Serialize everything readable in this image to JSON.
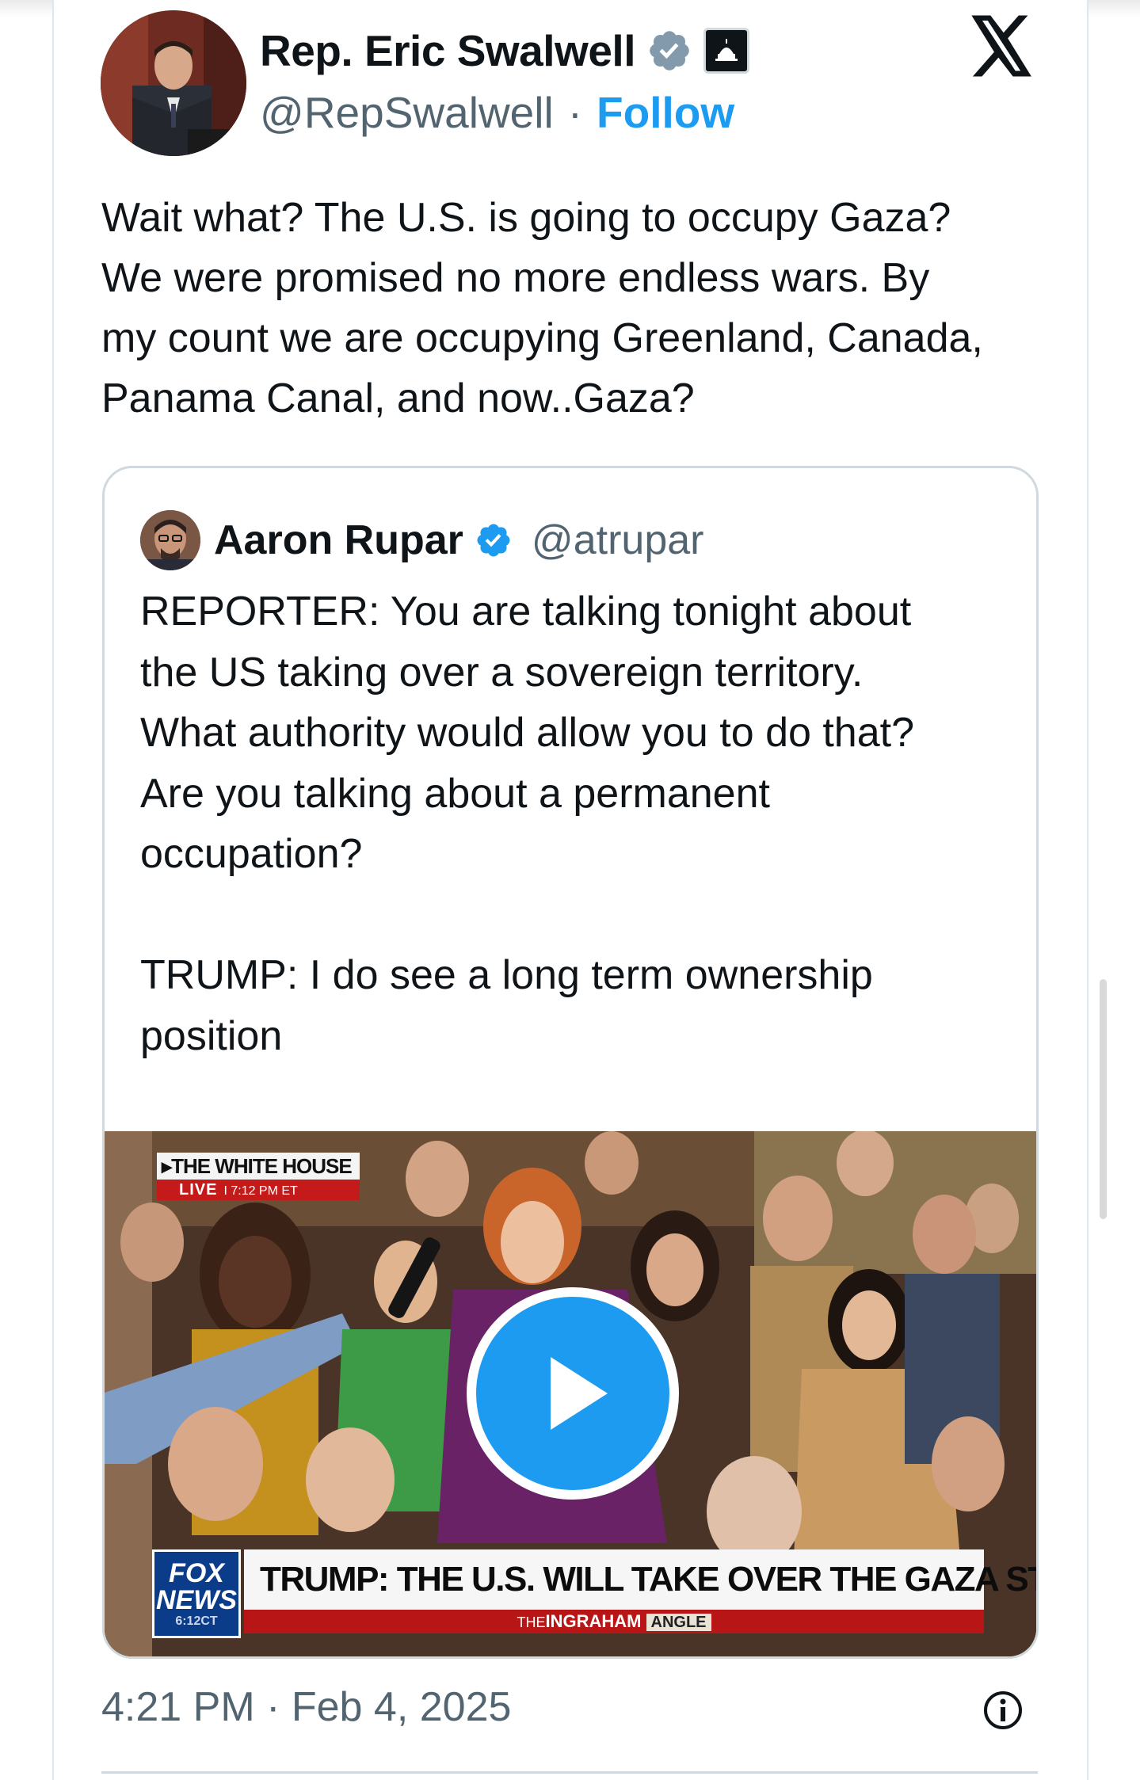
{
  "author": {
    "name": "Rep. Eric Swalwell",
    "handle": "@RepSwalwell",
    "separator": "·",
    "follow_label": "Follow"
  },
  "tweet": {
    "text": "Wait what? The U.S. is going to occupy Gaza?\nWe were promised no more endless wars. By\nmy count we are occupying Greenland, Canada,\nPanama Canal, and now..Gaza?"
  },
  "quote": {
    "name": "Aaron Rupar",
    "handle": "@atrupar",
    "text": "REPORTER: You are talking tonight about\nthe US taking over a sovereign territory.\nWhat authority would allow you to do that?\nAre you talking about a permanent\noccupation?\n\nTRUMP: I do see a long term ownership\nposition",
    "video": {
      "bug_title": "THE WHITE HOUSE",
      "bug_live": "LIVE",
      "bug_time": "I 7:12 PM ET",
      "network_line1": "FOX",
      "network_line2": "NEWS",
      "network_time": "6:12CT",
      "headline": "TRUMP: THE U.S. WILL TAKE OVER THE GAZA STRIP",
      "show_prefix": "THE",
      "show_name": "INGRAHAM",
      "show_suffix": "ANGLE"
    }
  },
  "footer": {
    "timestamp": "4:21 PM · Feb 4, 2025"
  },
  "icons": {
    "verified": "verified-badge-icon",
    "affiliation": "capitol-dome-icon",
    "brand": "x-logo-icon",
    "play": "play-icon",
    "info": "info-icon"
  },
  "colors": {
    "accent": "#1d9bf0",
    "text": "#0f1419",
    "muted": "#536471",
    "border": "#cfd9de",
    "fox_red": "#b81616",
    "fox_blue": "#0b3c8a"
  }
}
